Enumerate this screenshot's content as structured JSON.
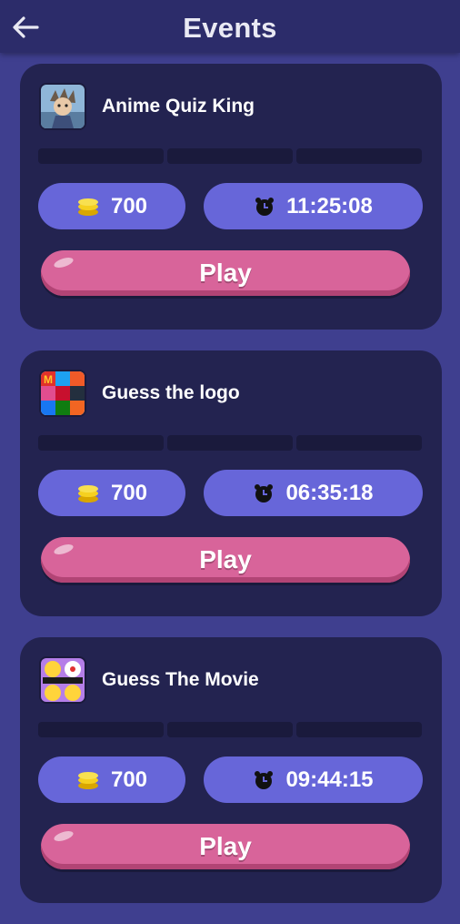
{
  "header": {
    "title": "Events",
    "back_icon": "arrow-left-icon"
  },
  "events": [
    {
      "name": "Anime Quiz King",
      "coins": "700",
      "timer": "11:25:08",
      "play_label": "Play",
      "thumb_icon": "anime-character-icon"
    },
    {
      "name": "Guess the logo",
      "coins": "700",
      "timer": "06:35:18",
      "play_label": "Play",
      "thumb_icon": "brand-logos-icon"
    },
    {
      "name": "Guess The Movie",
      "coins": "700",
      "timer": "09:44:15",
      "play_label": "Play",
      "thumb_icon": "movie-emoji-icon"
    }
  ],
  "colors": {
    "background": "#3f3f8f",
    "card": "#232350",
    "pill": "#6766d9",
    "play": "#d8649a",
    "coin": "#f5d020"
  }
}
